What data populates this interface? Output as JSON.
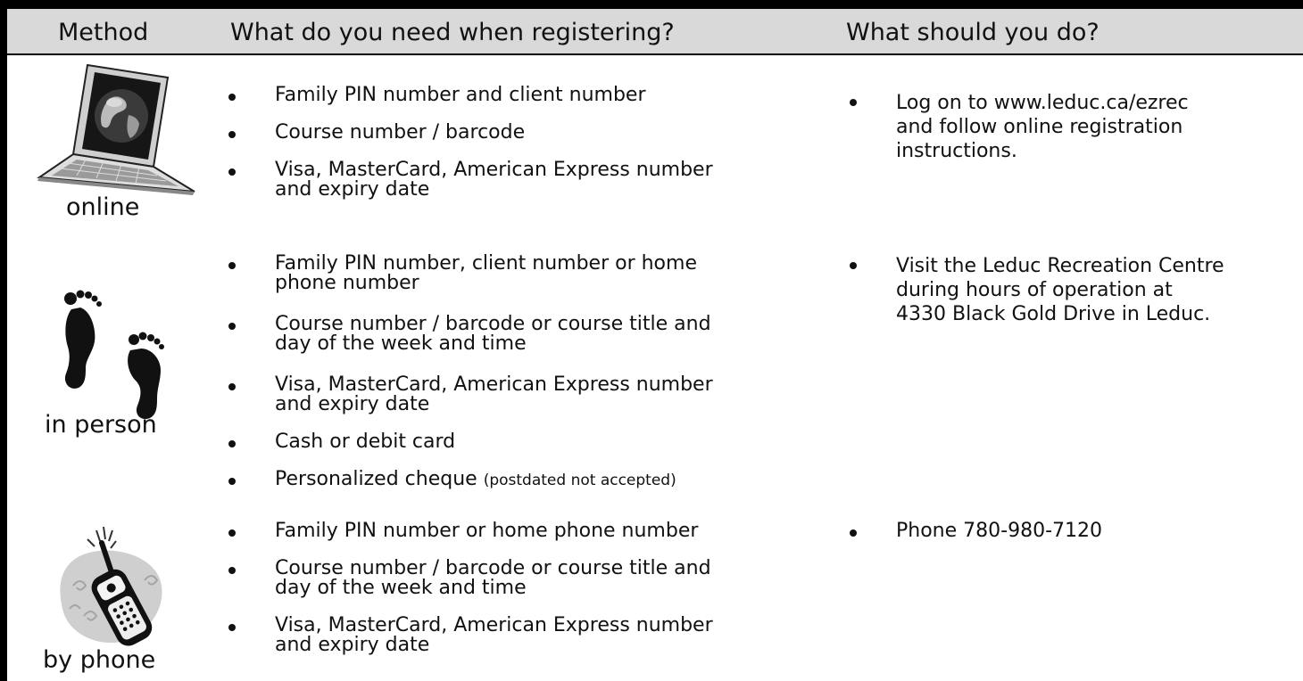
{
  "header": {
    "method": "Method",
    "need": "What do you need when registering?",
    "do": "What should you do?"
  },
  "rows": [
    {
      "label": "online",
      "icon": "laptop-globe-icon",
      "needs": [
        "Family PIN number and client number",
        "Course number / barcode",
        "Visa, MasterCard, American Express number",
        "and expiry date"
      ],
      "actions": [
        "Log on to www.leduc.ca/ezrec",
        "and follow online registration",
        "instructions."
      ]
    },
    {
      "label": "in person",
      "icon": "footprints-icon",
      "needs": [
        "Family PIN number, client number or home",
        "phone number",
        "Course number / barcode or course title and",
        "day of the week and time",
        "Visa, MasterCard, American Express number",
        "and expiry date",
        "Cash or debit card",
        "Personalized cheque",
        "(postdated not accepted)"
      ],
      "actions": [
        "Visit the Leduc Recreation Centre",
        "during hours of operation at",
        "4330 Black Gold Drive in Leduc."
      ]
    },
    {
      "label": "by phone",
      "icon": "ringing-phone-icon",
      "needs": [
        "Family PIN number or home phone number",
        "Course number / barcode or course title and",
        "day of the week and time",
        "Visa, MasterCard, American Express number",
        "and expiry date"
      ],
      "actions": [
        "Phone 780-980-7120"
      ]
    }
  ]
}
